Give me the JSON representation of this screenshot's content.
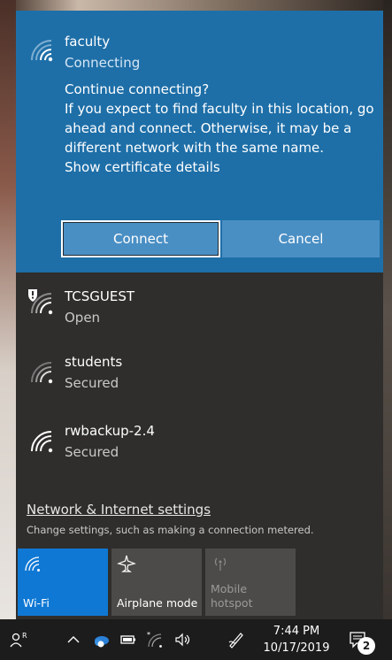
{
  "networks": {
    "active": {
      "name": "faculty",
      "status": "Connecting",
      "prompt_lines": [
        "Continue connecting?",
        "If you expect to find faculty in this location, go",
        "ahead and connect. Otherwise, it may be a",
        "different network with the same name.",
        "Show certificate details"
      ],
      "connect_label": "Connect",
      "cancel_label": "Cancel"
    },
    "list": [
      {
        "name": "TCSGUEST",
        "status": "Open"
      },
      {
        "name": "students",
        "status": "Secured"
      },
      {
        "name": "rwbackup-2.4",
        "status": "Secured"
      }
    ]
  },
  "settings": {
    "link": "Network & Internet settings",
    "subtitle": "Change settings, such as making a connection metered."
  },
  "tiles": [
    {
      "label": "Wi-Fi",
      "icon": "wifi-icon",
      "active": true
    },
    {
      "label": "Airplane mode",
      "icon": "airplane-icon",
      "active": false
    },
    {
      "label_line1": "Mobile",
      "label_line2": "hotspot",
      "icon": "hotspot-icon",
      "active": false
    }
  ],
  "taskbar": {
    "time": "7:44 PM",
    "date": "10/17/2019",
    "notification_count": "2"
  },
  "colors": {
    "accent": "#1e6fa8",
    "tile_active": "#0f78d4",
    "flyout_bg": "#2f2e2c",
    "taskbar_bg": "#1c1c1c"
  }
}
